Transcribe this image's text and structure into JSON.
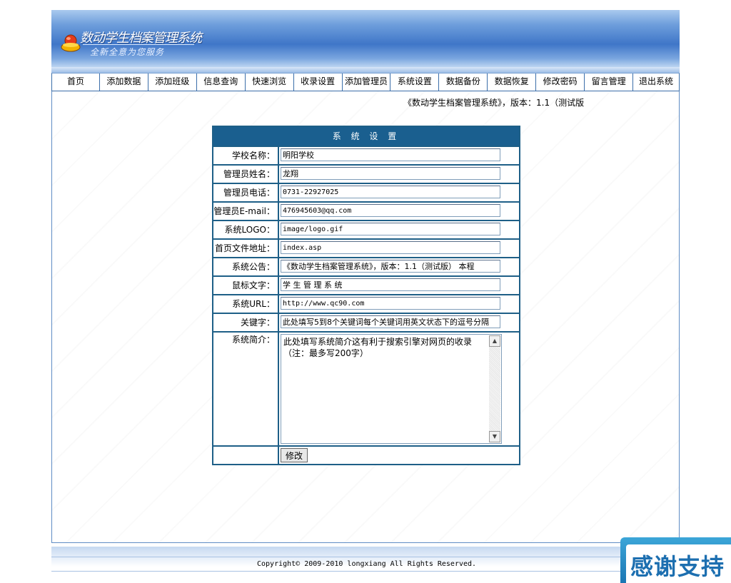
{
  "header": {
    "logo_title": "数动学生档案管理系统",
    "logo_subtitle": "全新全意为您服务"
  },
  "nav": {
    "items": [
      "首页",
      "添加数据",
      "添加班级",
      "信息查询",
      "快速浏览",
      "收录设置",
      "添加管理员",
      "系统设置",
      "数据备份",
      "数据恢复",
      "修改密码",
      "留言管理",
      "退出系统"
    ]
  },
  "announcement": "《数动学生档案管理系统》，版本：1.1（测试版",
  "form": {
    "title": "系 统 设 置",
    "fields": [
      {
        "label": "学校名称：",
        "value": "明阳学校"
      },
      {
        "label": "管理员姓名：",
        "value": "龙翔"
      },
      {
        "label": "管理员电话：",
        "value": "0731-22927025"
      },
      {
        "label": "管理员E-mail：",
        "value": "476945603@qq.com"
      },
      {
        "label": "系统LOGO：",
        "value": "image/logo.gif"
      },
      {
        "label": "首页文件地址：",
        "value": "index.asp"
      },
      {
        "label": "系统公告：",
        "value": "《数动学生档案管理系统》，版本：1.1（测试版）  本程"
      },
      {
        "label": "鼠标文字：",
        "value": "学 生 管 理 系 统"
      },
      {
        "label": "系统URL：",
        "value": "http://www.qc90.com"
      },
      {
        "label": "关键字：",
        "value": "此处填写5到8个关键词每个关键词用英文状态下的逗号分隔"
      }
    ],
    "intro_label": "系统简介：",
    "intro_value": "此处填写系统简介这有利于搜索引擎对网页的收录（注：最多写200字）",
    "submit_label": "修改"
  },
  "footer": {
    "copyright": "Copyright© 2009-2010 longxiang All Rights Reserved."
  },
  "corner_ad": {
    "text": "感谢支持"
  }
}
